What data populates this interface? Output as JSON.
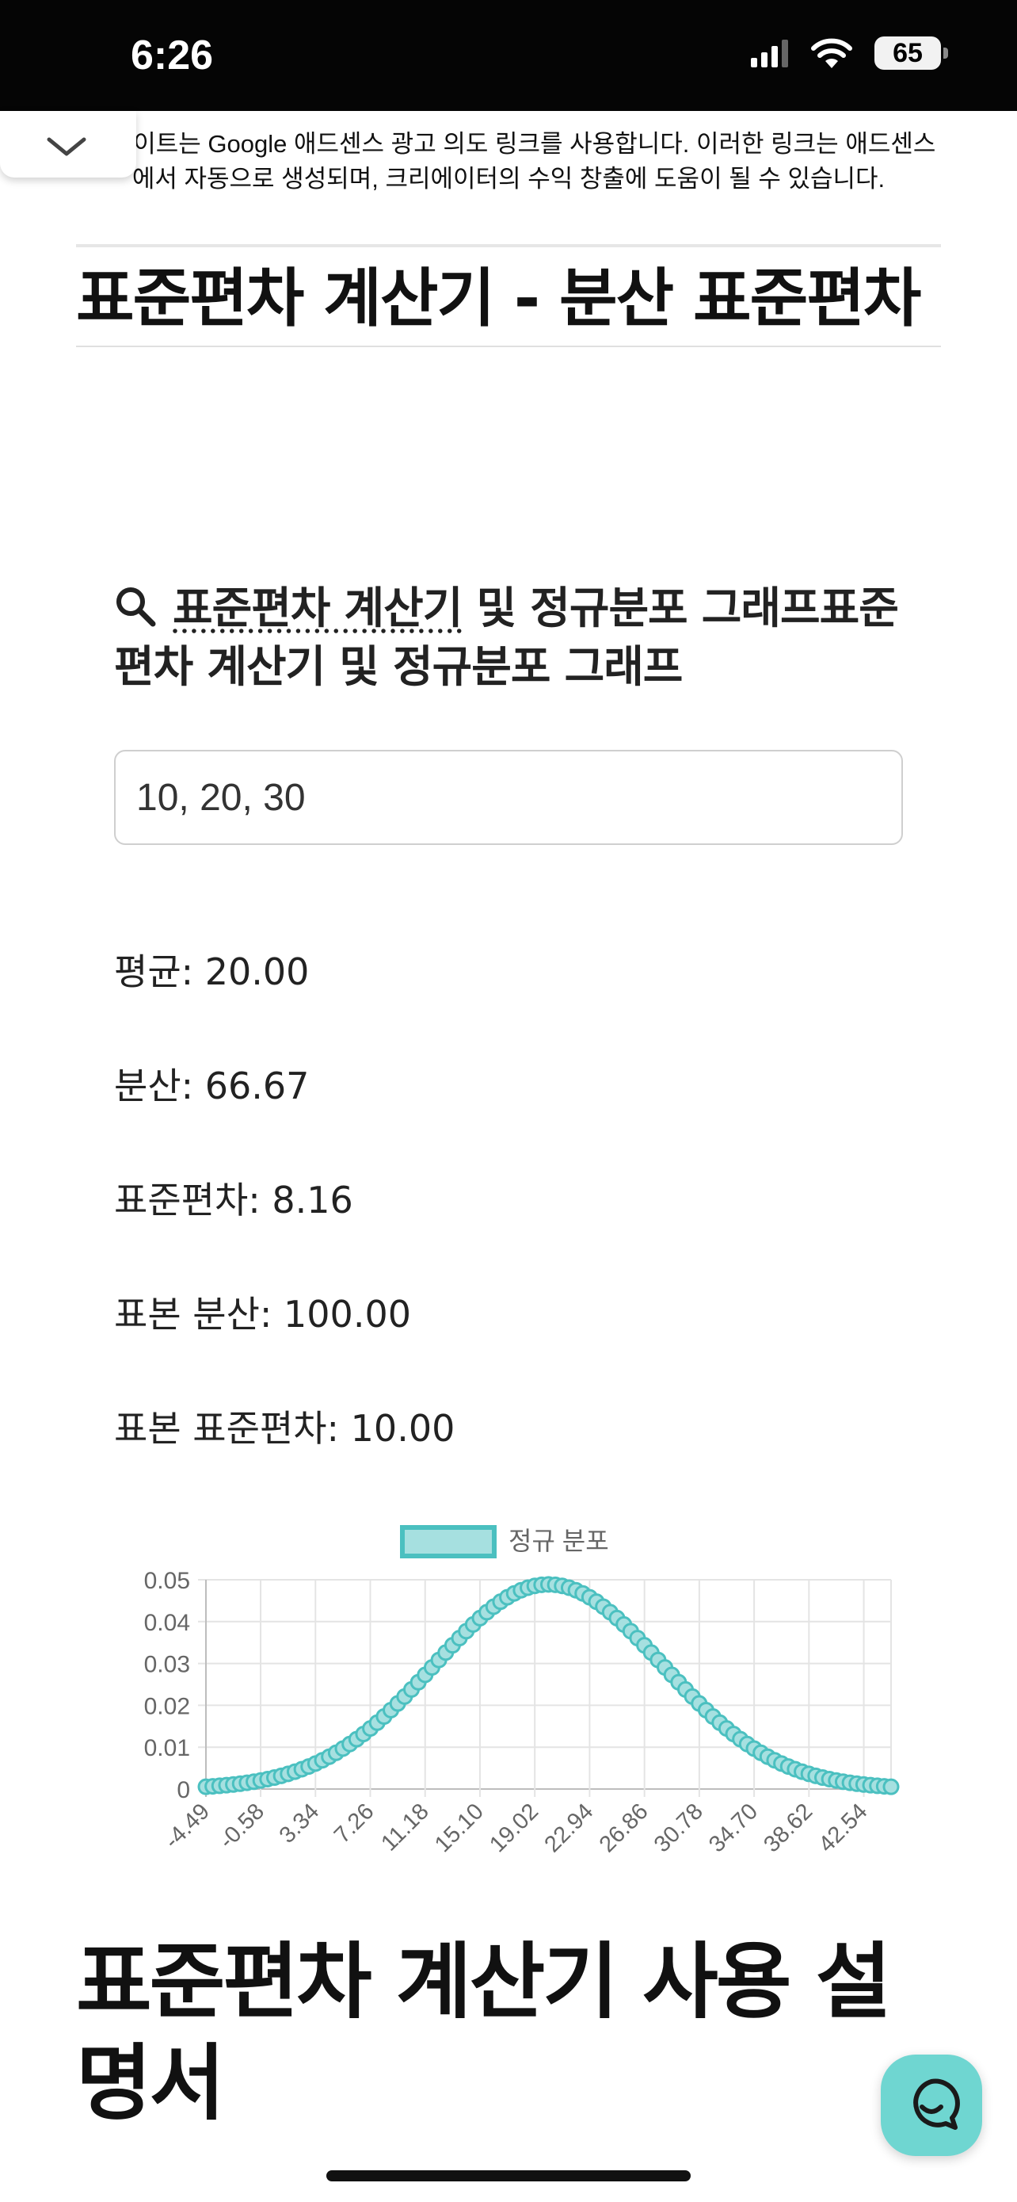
{
  "status_bar": {
    "time": "6:26",
    "battery": "65"
  },
  "ad_notice": "이 사이트는 Google 애드센스 광고 의도 링크를 사용합니다. 이러한 링크는 애드센스에서 자동으로 생성되며, 크리에이터의 수익 창출에 도움이 될 수 있습니다.",
  "page_title": "표준편차 계산기 - 분산 표준편차",
  "calculator": {
    "heading_link": "표준편차 계산기",
    "heading_rest": " 및 정규분포 그래프표준편차 계산기 및 정규분포 그래프",
    "input_value": "10, 20, 30"
  },
  "results": {
    "mean": "평균: 20.00",
    "variance": "분산: 66.67",
    "std_dev": "표준편차: 8.16",
    "sample_variance": "표본 분산: 100.00",
    "sample_std_dev": "표본 표준편차: 10.00"
  },
  "chart_data": {
    "type": "line",
    "legend": "정규 분포",
    "legend_position": "top",
    "grid": true,
    "mean": 20,
    "std": 8.16,
    "x_range": [
      -4.49,
      44.49
    ],
    "x_tick_labels": [
      "-4.49",
      "-0.58",
      "3.34",
      "7.26",
      "11.18",
      "15.10",
      "19.02",
      "22.94",
      "26.86",
      "30.78",
      "34.70",
      "38.62",
      "42.54"
    ],
    "y_tick_labels": [
      "0.05",
      "0.04",
      "0.03",
      "0.02",
      "0.01",
      "0"
    ],
    "ylim": [
      0,
      0.05
    ],
    "color": "#4bc0c0",
    "fill_color": "#a6e0e0"
  },
  "section_title": "표준편차 계산기 사용 설명서"
}
